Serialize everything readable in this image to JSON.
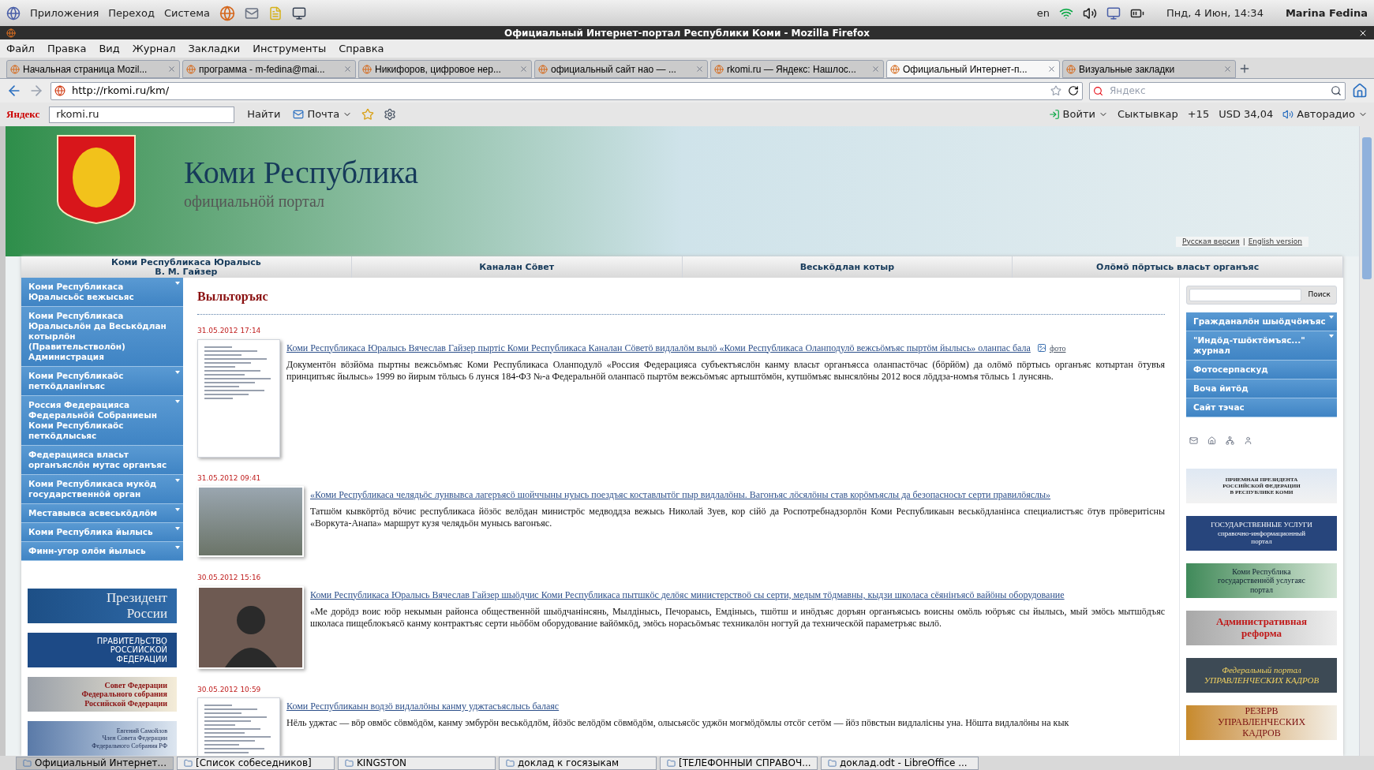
{
  "desktop_panel": {
    "menus": [
      "Приложения",
      "Переход",
      "Система"
    ],
    "keyboard": "en",
    "clock": "Пнд, 4 Июн, 14:34",
    "user": "Marina Fedina"
  },
  "window": {
    "title": "Официальный Интернет-портал Республики Коми - Mozilla Firefox"
  },
  "menu_bar": [
    "Файл",
    "Правка",
    "Вид",
    "Журнал",
    "Закладки",
    "Инструменты",
    "Справка"
  ],
  "tabs": [
    {
      "label": "Начальная страница Mozil...",
      "selected": false
    },
    {
      "label": "программа - m-fedina@mai...",
      "selected": false
    },
    {
      "label": "Никифоров, цифровое нер...",
      "selected": false
    },
    {
      "label": "официальный сайт нао — ...",
      "selected": false
    },
    {
      "label": "rkomi.ru — Яндекс: Нашлос...",
      "selected": false
    },
    {
      "label": "Официальный Интернет-п...",
      "selected": true
    },
    {
      "label": "Визуальные закладки",
      "selected": false
    }
  ],
  "address_bar": {
    "url": "http://rkomi.ru/km/",
    "search_placeholder": "Яндекс"
  },
  "yandex_bar": {
    "logo": "Яндекс",
    "search_value": "rkomi.ru",
    "find": "Найти",
    "mail": "Почта",
    "login": "Войти",
    "city": "Сыктывкар",
    "temperature": "+15",
    "currency": "USD 34,04",
    "radio": "Авторадио"
  },
  "site": {
    "title": "Коми Республика",
    "subtitle": "официальнӧй портал",
    "language_links": [
      "Русская версия",
      "English version"
    ],
    "language_separator": "|",
    "nav": [
      {
        "lines": [
          "Коми Республикаса Юралысь",
          "В. М. Гайзер"
        ]
      },
      {
        "lines": [
          "Каналан Сӧвет"
        ]
      },
      {
        "lines": [
          "Веськӧдлан котыр"
        ]
      },
      {
        "lines": [
          "Олӧмӧ пӧртысь власьт органъяс"
        ]
      }
    ],
    "left_menu": [
      {
        "label": "Коми Республикаса Юралысьӧс вежысьяс",
        "has_submenu": true
      },
      {
        "label": "Коми Республикаса Юралысьлӧн да Веськӧдлан котырлӧн (Правительстволӧн) Администрация",
        "has_submenu": false
      },
      {
        "label": "Коми Республикаӧс петкӧдланiнъяс",
        "has_submenu": true
      },
      {
        "label": "Россия Федерацияса Федеральнӧй Собраниеын Коми Республикаӧс петкӧдлысьяс",
        "has_submenu": true
      },
      {
        "label": "Федерацияса власьт органъяслӧн мутас органъяс",
        "has_submenu": false
      },
      {
        "label": "Коми Республикаса мукӧд государственнӧй орган",
        "has_submenu": true
      },
      {
        "label": "Меставывса асвеськӧдлӧм",
        "has_submenu": true
      },
      {
        "label": "Коми Республика йылысь",
        "has_submenu": true
      },
      {
        "label": "Финн-угор олӧм йылысь",
        "has_submenu": true
      }
    ],
    "left_banners": [
      {
        "lines": [
          "Президент",
          "России"
        ]
      },
      {
        "lines": [
          "ПРАВИТЕЛЬСТВО",
          "РОССИЙСКОЙ",
          "ФЕДЕРАЦИИ"
        ]
      },
      {
        "lines": [
          "Совет Федерации",
          "Федерального собрания",
          "Российской Федерации"
        ]
      },
      {
        "lines": [
          "Евгений Самойлов",
          "Член Совета Федерации",
          "Федерального Собрания РФ"
        ]
      }
    ],
    "section_title": "Выльторъяс",
    "articles": [
      {
        "date": "31.05.2012 17:14",
        "kind": "document",
        "title": "Коми Республикаса Юралысь Вячеслав Гайзер пыртiс Коми Республикаса Каналан Сӧветӧ видлалӧм вылӧ «Коми Республикаса Оланподулӧ вежсьӧмъяс пыртӧм йылысь» оланпас бала",
        "photo_link": "фото",
        "body": "Документӧн вӧзйӧма пыртны вежсьӧмъяс Коми Республикаса Оланподулӧ «Россия Федерацияса субъектъяслӧн канму власьт органъясса оланпастӧчас (бӧрйӧм) да олӧмӧ пӧртысь органъяс котыртан ӧтувъя принципъяс йылысь» 1999 во йирым тӧлысь 6 лунся 184-ФЗ №-а Федеральнӧй оланпасӧ пыртӧм вежсьӧмъяс артыштӧмӧн, кутшӧмъяс вынсялӧны 2012 вося лӧддза-номъя тӧлысь 1 лунсянь."
      },
      {
        "date": "31.05.2012 09:41",
        "kind": "photo",
        "title": "«Коми Республикаса челядьӧс лунвывса лагеръясӧ шойччыны нуысь поездъяс коставлытӧг пыр видлалӧны. Вагонъяс лӧсялӧны став корӧмъяслы да безопасносьт серти правилӧяслы»",
        "body": "Татшӧм кывкӧртӧд вӧчис республикаса йӧзӧс велӧдан министрӧс медводдза вежысь Николай Зуев, кор сiйӧ да Роспотребнадзорлӧн Коми Республикаын веськӧдланiнса специалистъяс ӧтув прӧверитiсны «Воркута-Анапа» маршрут кузя челядьӧн мунысь вагонъяс."
      },
      {
        "date": "30.05.2012 15:16",
        "kind": "portrait",
        "title": "Коми Республикаса Юралысь Вячеслав Гайзер шыӧдчис Коми Республикаса пытшкӧс делӧяс министерствоӧ сы серти, медым тӧдмавны, кыдзи школаса сёянiнъясӧ вайӧны оборудование",
        "body": "«Ме дорӧдз воис юӧр некымын районса общественнӧй шыӧдчанiнсянь, Мылдiнысь, Печораысь, Емдiнысь, тшӧтш и инӧдъяс доръян органъясысь воисны омӧль юӧръяс сы йылысь, мый эмӧсь мытшӧдъяс школаса пищеблокъясӧ канму контрактъяс серти ньӧбӧм оборудование вайӧмкӧд, эмӧсь норасьӧмъяс техникалӧн ногтуй да техническӧй параметръяс вылӧ."
      },
      {
        "date": "30.05.2012 10:59",
        "kind": "document",
        "title": "Коми Республикаын водзӧ видлалӧны канму уджтасъяслысь балаяс",
        "body": "Нёль уджтас — вӧр овмӧс сӧвмӧдӧм, канму эмбурӧн веськӧдлӧм, йӧзӧс велӧдӧм сӧвмӧдӧм, олысьясӧс уджӧн могмӧдӧмлы отсӧг сетӧм — йӧз пӧвстын видлалiсны уна. Нӧшта видлалӧны на кык"
      }
    ],
    "search_button": "Поиск",
    "right_menu": [
      {
        "label": "Гражданалӧн шыӧдчӧмъяс",
        "has_submenu": true
      },
      {
        "label": "\"Индӧд-тшӧктӧмъяс...\" журнал",
        "has_submenu": true
      },
      {
        "label": "Фотосерпаскуд",
        "has_submenu": false
      },
      {
        "label": "Воча йитӧд",
        "has_submenu": false
      },
      {
        "label": "Сайт тэчас",
        "has_submenu": false
      }
    ],
    "right_banners": [
      {
        "lines": [
          "ПРИЕМНАЯ ПРЕЗИДЕНТА",
          "РОССИЙСКОЙ ФЕДЕРАЦИИ",
          "В РЕСПУБЛИКЕ КОМИ"
        ]
      },
      {
        "lines": [
          "ГОСУДАРСТВЕННЫЕ УСЛУГИ",
          "справочно-информационный",
          "портал"
        ]
      },
      {
        "lines": [
          "Коми Республика",
          "государственнӧй услугаяс",
          "портал"
        ]
      },
      {
        "lines": [
          "Административная",
          "реформа"
        ]
      },
      {
        "lines": [
          "Федеральный портал",
          "УПРАВЛЕНЧЕСКИХ КАДРОВ"
        ]
      },
      {
        "lines": [
          "РЕЗЕРВ",
          "УПРАВЛЕНЧЕСКИХ",
          "КАДРОВ"
        ]
      }
    ]
  },
  "taskbar": [
    {
      "label": "Официальный Интернет...",
      "selected": true
    },
    {
      "label": "[Список собеседников]",
      "selected": false
    },
    {
      "label": "KINGSTON",
      "selected": false
    },
    {
      "label": "доклад к госязыкам",
      "selected": false
    },
    {
      "label": "[ТЕЛЕФОННЫИ СПРАВОЧ...",
      "selected": false
    },
    {
      "label": "доклад.odt - LibreOffice ...",
      "selected": false
    }
  ]
}
